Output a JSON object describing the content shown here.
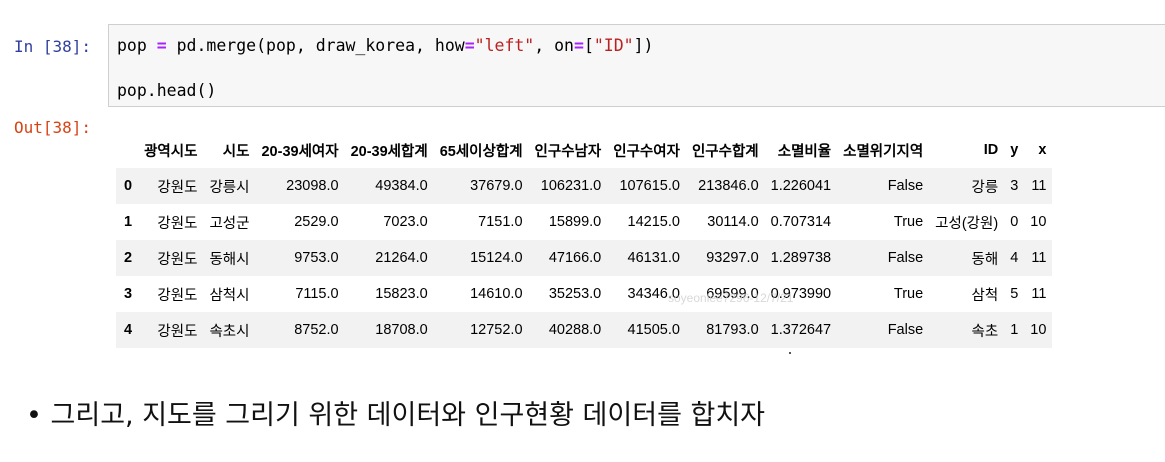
{
  "input_prompt": "In [38]:",
  "output_prompt": "Out[38]:",
  "code": {
    "line1": [
      {
        "t": "pop ",
        "c": "plain"
      },
      {
        "t": "=",
        "c": "op"
      },
      {
        "t": " pd.merge(pop, draw_korea, how",
        "c": "plain"
      },
      {
        "t": "=",
        "c": "op"
      },
      {
        "t": "\"left\"",
        "c": "str"
      },
      {
        "t": ", on",
        "c": "plain"
      },
      {
        "t": "=",
        "c": "op"
      },
      {
        "t": "[",
        "c": "plain"
      },
      {
        "t": "\"ID\"",
        "c": "str"
      },
      {
        "t": "])",
        "c": "plain"
      }
    ],
    "line2": "pop.head()"
  },
  "table": {
    "columns": [
      "",
      "광역시도",
      "시도",
      "20-39세여자",
      "20-39세합계",
      "65세이상합계",
      "인구수남자",
      "인구수여자",
      "인구수합계",
      "소멸비율",
      "소멸위기지역",
      "ID",
      "y",
      "x"
    ],
    "rows": [
      [
        "0",
        "강원도",
        "강릉시",
        "23098.0",
        "49384.0",
        "37679.0",
        "106231.0",
        "107615.0",
        "213846.0",
        "1.226041",
        "False",
        "강릉",
        "3",
        "11"
      ],
      [
        "1",
        "강원도",
        "고성군",
        "2529.0",
        "7023.0",
        "7151.0",
        "15899.0",
        "14215.0",
        "30114.0",
        "0.707314",
        "True",
        "고성(강원)",
        "0",
        "10"
      ],
      [
        "2",
        "강원도",
        "동해시",
        "9753.0",
        "21264.0",
        "15124.0",
        "47166.0",
        "46131.0",
        "93297.0",
        "1.289738",
        "False",
        "동해",
        "4",
        "11"
      ],
      [
        "3",
        "강원도",
        "삼척시",
        "7115.0",
        "15823.0",
        "14610.0",
        "35253.0",
        "34346.0",
        "69599.0",
        "0.973990",
        "True",
        "삼척",
        "5",
        "11"
      ],
      [
        "4",
        "강원도",
        "속초시",
        "8752.0",
        "18708.0",
        "12752.0",
        "40288.0",
        "41505.0",
        "81793.0",
        "1.372647",
        "False",
        "속초",
        "1",
        "10"
      ]
    ]
  },
  "watermark": "soyeonlee7296-12/7/21",
  "bullet_text": "• 그리고, 지도를 그리기 위한 데이터와 인구현황 데이터를 합치자"
}
